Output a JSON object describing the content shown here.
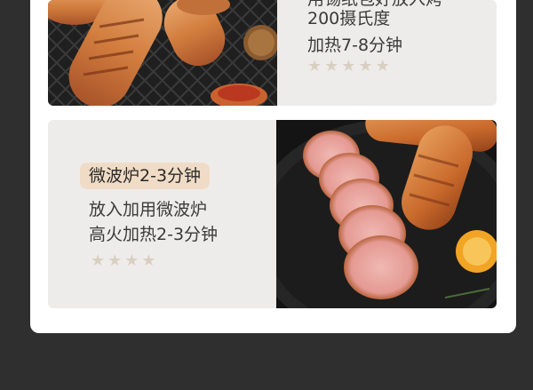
{
  "top_card": {
    "cut_line": "用锡纸包好放入烤",
    "line1": "200摄氏度",
    "line2": "加热7-8分钟",
    "stars": 5
  },
  "bottom_card": {
    "badge": "微波炉2-3分钟",
    "line1": "放入加用微波炉",
    "line2": "高火加热2-3分钟",
    "stars": 4
  },
  "icons": {
    "star": "★"
  },
  "colors": {
    "page_bg": "#2f2f2f",
    "card_bg": "#ffffff",
    "panel_bg": "#eeecea",
    "badge_bg": "#f0dcc6",
    "star": "#d9cfc1"
  }
}
